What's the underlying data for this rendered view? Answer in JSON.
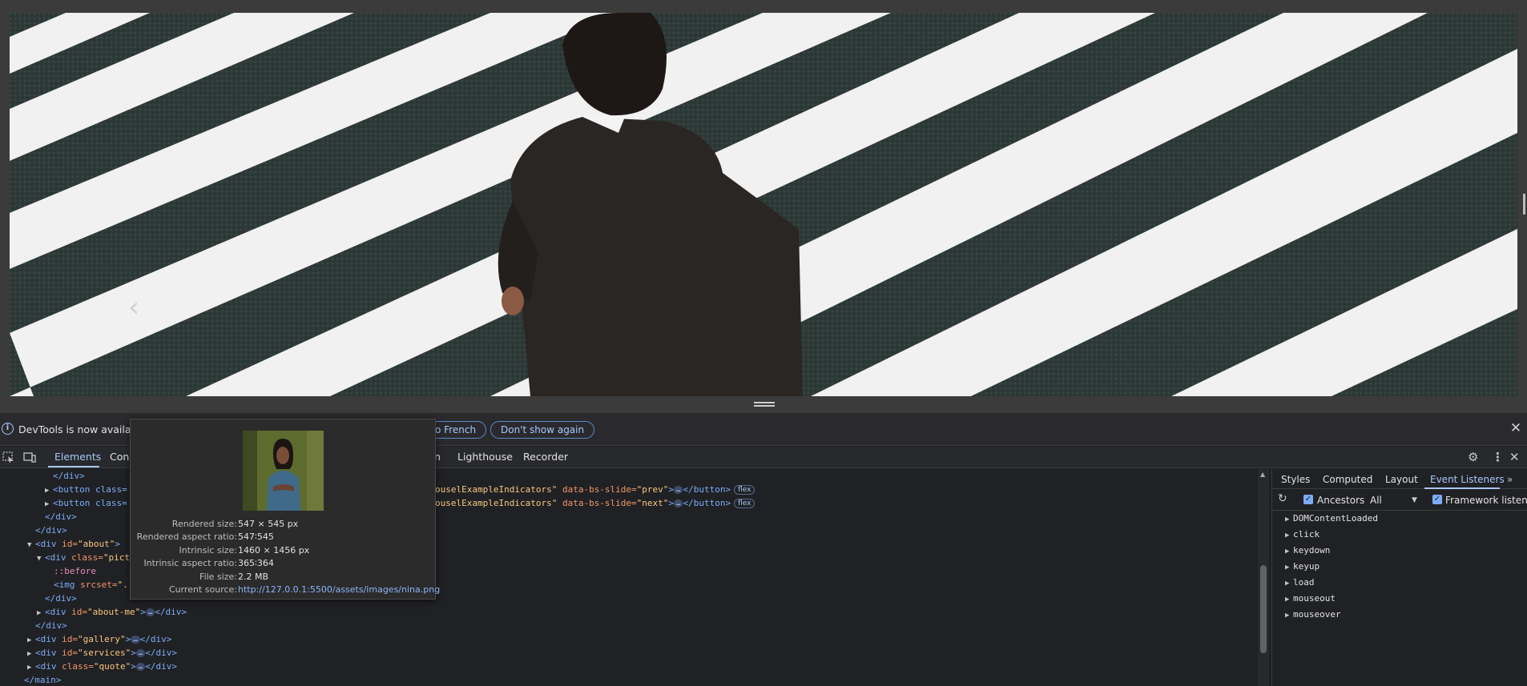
{
  "viewport": {
    "carousel_prev_icon": "chevron-left-icon"
  },
  "infobar": {
    "text": "DevTools is now available i",
    "switch_label": "o French",
    "dont_show_label": "Don't show again",
    "close_icon": "close-icon"
  },
  "toolbar": {
    "tabs": [
      "Elements",
      "Cons",
      "n",
      "Lighthouse",
      "Recorder"
    ],
    "active_tab": "Elements"
  },
  "elements_tree": {
    "l1": "</div>",
    "l2_tag": "<button class=",
    "l2_rest_attr": "ouselExampleIndicators\"",
    "l2_slide_attr": "data-bs-slide=",
    "l2_slide_val": "\"prev\"",
    "l3_tag": "<button class=",
    "l3_rest_attr": "ouselExampleIndicators\"",
    "l3_slide_attr": "data-bs-slide=",
    "l3_slide_val": "\"next\"",
    "close_button": "</button>",
    "flex_badge": "flex",
    "ellipsis": "…",
    "gt": ">",
    "l4": "</div>",
    "l5": "</div>",
    "l6_open": "<div ",
    "l6_attr": "id=",
    "l6_val": "\"about\"",
    "l6_close": ">",
    "l7_open": "<div ",
    "l7_attr": "class=",
    "l7_val": "\"pictu",
    "l8": "::before",
    "l9_open": "<img ",
    "l9_attr": "srcset=",
    "l9_val": "\"..",
    "l10": "</div>",
    "l11_open": "<div ",
    "l11_attr": "id=",
    "l11_val": "\"about-me\"",
    "l11_close": "</div>",
    "l12": "</div>",
    "l13_val": "\"gallery\"",
    "l14_val": "\"services\"",
    "l15_attr": "class=",
    "l15_val": "\"quote\"",
    "l16": "</main>"
  },
  "sidebar": {
    "tabs": [
      "Styles",
      "Computed",
      "Layout",
      "Event Listeners"
    ],
    "active_tab": "Event Listeners",
    "more_icon": "chevron-double-right-icon",
    "refresh_icon": "refresh-icon",
    "ancestors_label": "Ancestors",
    "filter_value": "All",
    "framework_label": "Framework listen...",
    "events": [
      "DOMContentLoaded",
      "click",
      "keydown",
      "keyup",
      "load",
      "mouseout",
      "mouseover"
    ]
  },
  "tooltip": {
    "rows": [
      {
        "label": "Rendered size:",
        "value": "547 × 545 px"
      },
      {
        "label": "Rendered aspect ratio:",
        "value": "547∶545"
      },
      {
        "label": "Intrinsic size:",
        "value": "1460 × 1456 px"
      },
      {
        "label": "Intrinsic aspect ratio:",
        "value": "365∶364"
      },
      {
        "label": "File size:",
        "value": "2.2 MB"
      },
      {
        "label": "Current source:",
        "value": "http://127.0.0.1:5500/assets/images/nina.png"
      }
    ]
  }
}
